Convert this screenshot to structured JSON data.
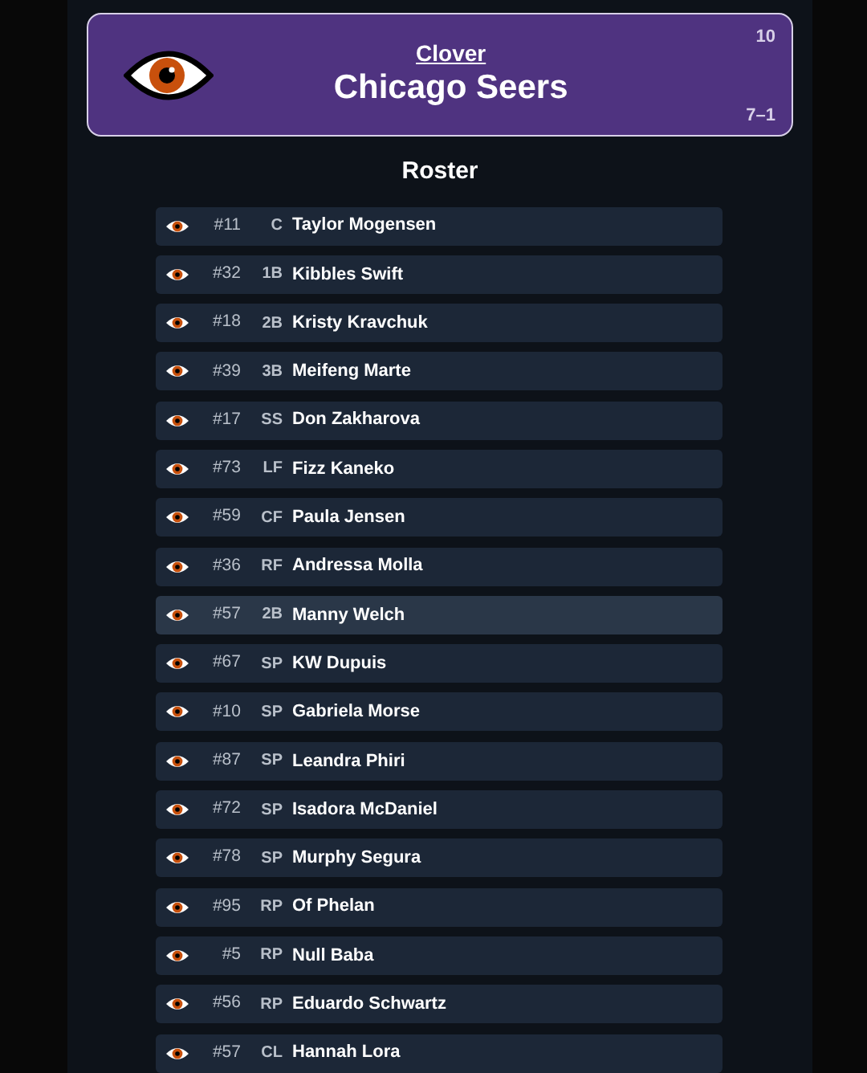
{
  "team": {
    "league": "Clover",
    "name": "Chicago Seers",
    "rank": "10",
    "record": "7–1"
  },
  "roster_title": "Roster",
  "players": [
    {
      "number": "#11",
      "position": "C",
      "name": "Taylor Mogensen",
      "selected": false
    },
    {
      "number": "#32",
      "position": "1B",
      "name": "Kibbles Swift",
      "selected": false
    },
    {
      "number": "#18",
      "position": "2B",
      "name": "Kristy Kravchuk",
      "selected": false
    },
    {
      "number": "#39",
      "position": "3B",
      "name": "Meifeng Marte",
      "selected": false
    },
    {
      "number": "#17",
      "position": "SS",
      "name": "Don Zakharova",
      "selected": false
    },
    {
      "number": "#73",
      "position": "LF",
      "name": "Fizz Kaneko",
      "selected": false
    },
    {
      "number": "#59",
      "position": "CF",
      "name": "Paula Jensen",
      "selected": false
    },
    {
      "number": "#36",
      "position": "RF",
      "name": "Andressa Molla",
      "selected": false
    },
    {
      "number": "#57",
      "position": "2B",
      "name": "Manny Welch",
      "selected": true
    },
    {
      "number": "#67",
      "position": "SP",
      "name": "KW Dupuis",
      "selected": false
    },
    {
      "number": "#10",
      "position": "SP",
      "name": "Gabriela Morse",
      "selected": false
    },
    {
      "number": "#87",
      "position": "SP",
      "name": "Leandra Phiri",
      "selected": false
    },
    {
      "number": "#72",
      "position": "SP",
      "name": "Isadora McDaniel",
      "selected": false
    },
    {
      "number": "#78",
      "position": "SP",
      "name": "Murphy Segura",
      "selected": false
    },
    {
      "number": "#95",
      "position": "RP",
      "name": "Of Phelan",
      "selected": false
    },
    {
      "number": "#5",
      "position": "RP",
      "name": "Null Baba",
      "selected": false
    },
    {
      "number": "#56",
      "position": "RP",
      "name": "Eduardo Schwartz",
      "selected": false
    },
    {
      "number": "#57",
      "position": "CL",
      "name": "Hannah Lora",
      "selected": false
    }
  ]
}
